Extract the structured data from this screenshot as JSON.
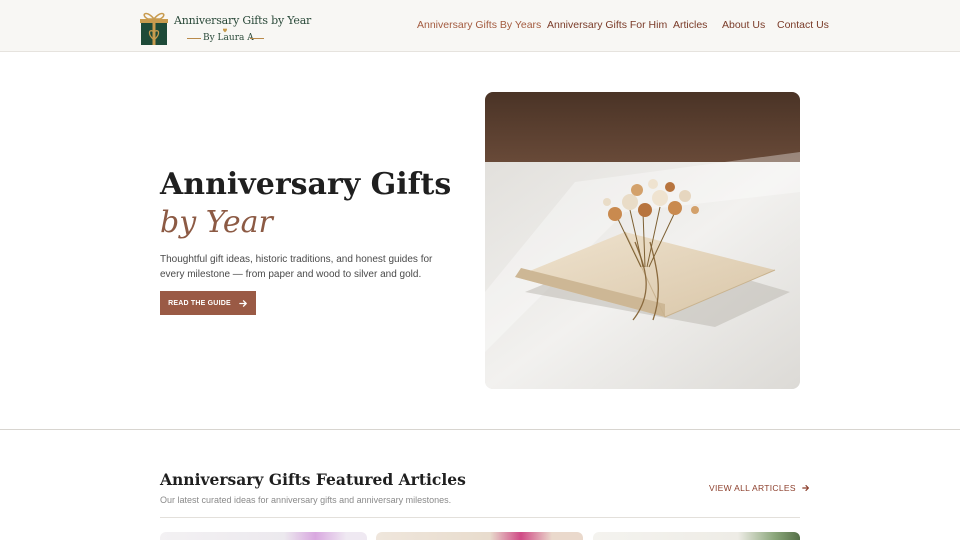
{
  "header": {
    "logo": {
      "title": "Anniversary Gifts by Year",
      "subtitle": "By Laura A"
    },
    "nav": [
      {
        "label": "Anniversary Gifts By Years",
        "active": true
      },
      {
        "label": "Anniversary Gifts For Him",
        "active": false
      },
      {
        "label": "Articles",
        "active": false
      },
      {
        "label": "About Us",
        "active": false
      },
      {
        "label": "Contact Us",
        "active": false
      }
    ]
  },
  "hero": {
    "title_line1": "Anniversary Gifts",
    "title_line2": "by Year",
    "description": "Thoughtful gift ideas, historic traditions, and honest guides for every milestone — from paper and wood to silver and gold.",
    "cta_label": "READ THE GUIDE",
    "cta_icon": "arrow-right-icon"
  },
  "featured": {
    "title": "Anniversary Gifts Featured Articles",
    "subtitle": "Our latest curated ideas for anniversary gifts and anniversary milestones.",
    "view_all_label": "VIEW ALL ARTICLES",
    "view_all_icon": "arrow-right-icon"
  },
  "colors": {
    "accent": "#9a5a45",
    "nav_text": "#7a3b28",
    "logo_green": "#2b4a3a",
    "logo_gold": "#c89b4e"
  }
}
